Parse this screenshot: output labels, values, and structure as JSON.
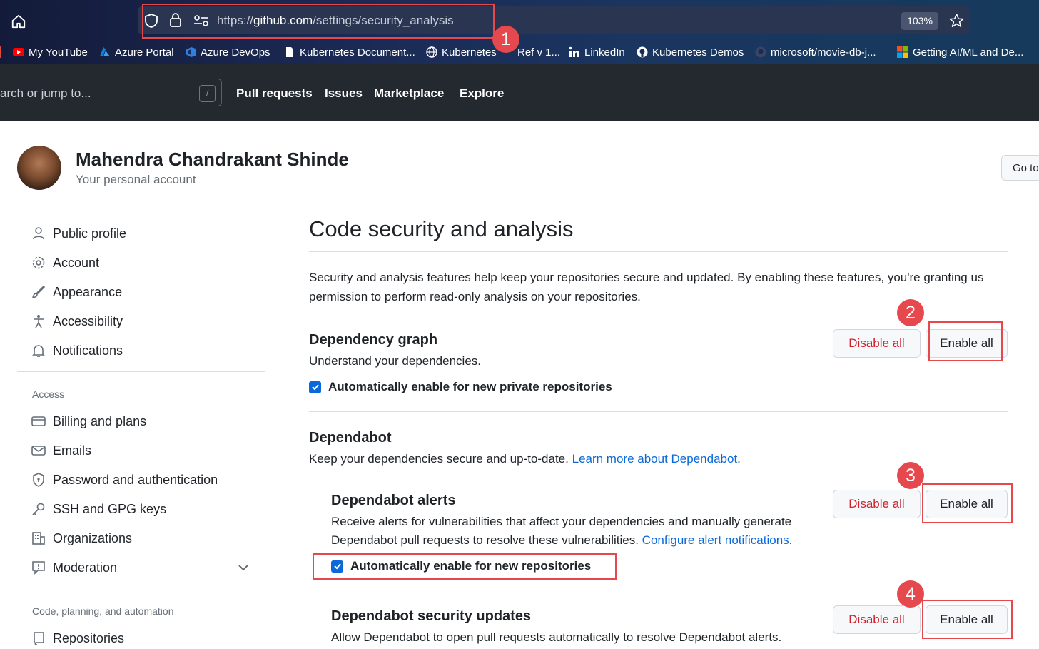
{
  "browser": {
    "url_prefix": "https://",
    "url_domain": "github.com",
    "url_path": "/settings/security_analysis",
    "zoom": "103%",
    "bookmarks": [
      "My YouTube",
      "Azure Portal",
      "Azure DevOps",
      "Kubernetes Document...",
      "Kubernetes",
      "Ref v 1...",
      "LinkedIn",
      "Kubernetes Demos",
      "microsoft/movie-db-j...",
      "Getting AI/ML and De..."
    ]
  },
  "header": {
    "search_placeholder": "arch or jump to...",
    "slash": "/",
    "nav": [
      "Pull requests",
      "Issues",
      "Marketplace",
      "Explore"
    ]
  },
  "profile": {
    "name": "Mahendra Chandrakant Shinde",
    "subtitle": "Your personal account",
    "goto_label": "Go to"
  },
  "sidebar": {
    "items": [
      "Public profile",
      "Account",
      "Appearance",
      "Accessibility",
      "Notifications"
    ],
    "access_heading": "Access",
    "access_items": [
      "Billing and plans",
      "Emails",
      "Password and authentication",
      "SSH and GPG keys",
      "Organizations",
      "Moderation"
    ],
    "code_heading": "Code, planning, and automation",
    "code_items": [
      "Repositories"
    ]
  },
  "main": {
    "title": "Code security and analysis",
    "intro": "Security and analysis features help keep your repositories secure and updated. By enabling these features, you're granting us permission to perform read-only analysis on your repositories.",
    "dependency_graph": {
      "heading": "Dependency graph",
      "desc": "Understand your dependencies.",
      "checkbox": "Automatically enable for new private repositories",
      "checked": true,
      "disable_label": "Disable all",
      "enable_label": "Enable all"
    },
    "dependabot": {
      "heading": "Dependabot",
      "desc": "Keep your dependencies secure and up-to-date.",
      "link": "Learn more about Dependabot",
      "period": "."
    },
    "dependabot_alerts": {
      "heading": "Dependabot alerts",
      "desc_line1": "Receive alerts for vulnerabilities that affect your dependencies and manually generate",
      "desc_line2": "Dependabot pull requests to resolve these vulnerabilities.",
      "link": "Configure alert notifications",
      "period": ".",
      "checkbox": "Automatically enable for new repositories",
      "checked": true,
      "disable_label": "Disable all",
      "enable_label": "Enable all"
    },
    "dependabot_security": {
      "heading": "Dependabot security updates",
      "desc": "Allow Dependabot to open pull requests automatically to resolve Dependabot alerts.",
      "disable_label": "Disable all",
      "enable_label": "Enable all"
    }
  },
  "annotations": [
    "1",
    "2",
    "3",
    "4"
  ],
  "colors": {
    "accent": "#0969da",
    "danger": "#cf222e",
    "annotation": "#e5484d",
    "header": "#24292f"
  }
}
